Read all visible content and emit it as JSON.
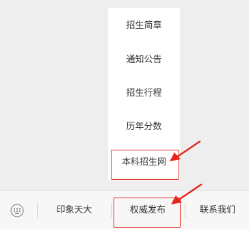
{
  "popup_menu": {
    "items": [
      {
        "label": "招生简章"
      },
      {
        "label": "通知公告"
      },
      {
        "label": "招生行程"
      },
      {
        "label": "历年分数"
      },
      {
        "label": "本科招生网"
      }
    ]
  },
  "tab_bar": {
    "keyboard_icon": "keyboard-icon",
    "tabs": [
      {
        "label": "印象天大"
      },
      {
        "label": "权威发布"
      },
      {
        "label": "联系我们"
      }
    ]
  },
  "colors": {
    "highlight": "#e5261b",
    "background": "#eeeeee",
    "menu_background": "#ffffff",
    "tabbar_background": "#f7f7f7",
    "text": "#333333"
  }
}
